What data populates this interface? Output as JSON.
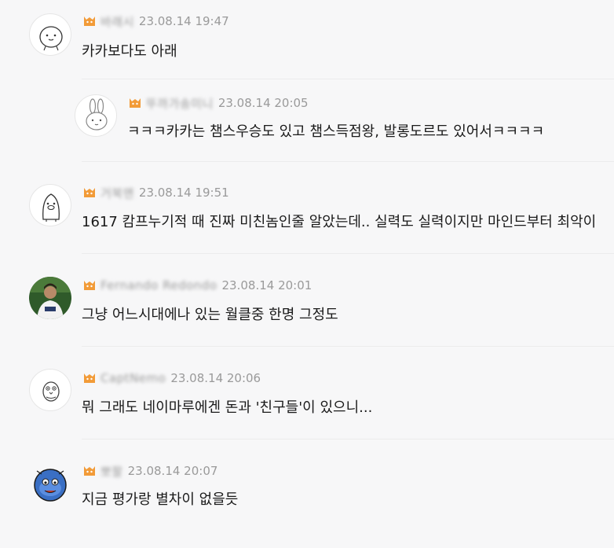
{
  "comments": [
    {
      "nickname": "바래시",
      "time": "23.08.14 19:47",
      "text": "카카보다도 아래",
      "avatar_icon": "smiley-doodle-icon",
      "is_reply": false
    },
    {
      "nickname": "뚜까가송미니",
      "time": "23.08.14 20:05",
      "text": "ㅋㅋㅋ카카는 챔스우승도 있고 챔스득점왕, 발롱도르도 있어서ㅋㅋㅋㅋ",
      "avatar_icon": "rabbit-doodle-icon",
      "is_reply": true
    },
    {
      "nickname": "거북맨",
      "time": "23.08.14 19:51",
      "text": "1617 캄프누기적 때 진짜 미친놈인줄 알았는데.. 실력도 실력이지만 마인드부터 최악이",
      "avatar_icon": "penguin-doodle-icon",
      "is_reply": false
    },
    {
      "nickname": "Fernando Redondo",
      "time": "23.08.14 20:01",
      "text": "그냥 어느시대에나 있는 월클중 한명 그정도",
      "avatar_icon": "player-photo-icon",
      "is_reply": false
    },
    {
      "nickname": "CaptNemo",
      "time": "23.08.14 20:06",
      "text": "뭐 그래도 네이마루에겐 돈과 '친구들'이 있으니...",
      "avatar_icon": "bird-doodle-icon",
      "is_reply": false
    },
    {
      "nickname": "뽀팔",
      "time": "23.08.14 20:07",
      "text": "지금 평가랑 별차이 없을듯",
      "avatar_icon": "cartoon-character-icon",
      "is_reply": false
    }
  ],
  "colors": {
    "background": "#f7f7f8",
    "meta_text": "#9a9a9a",
    "body_text": "#1a1a1a",
    "badge_orange": "#f29b38"
  }
}
